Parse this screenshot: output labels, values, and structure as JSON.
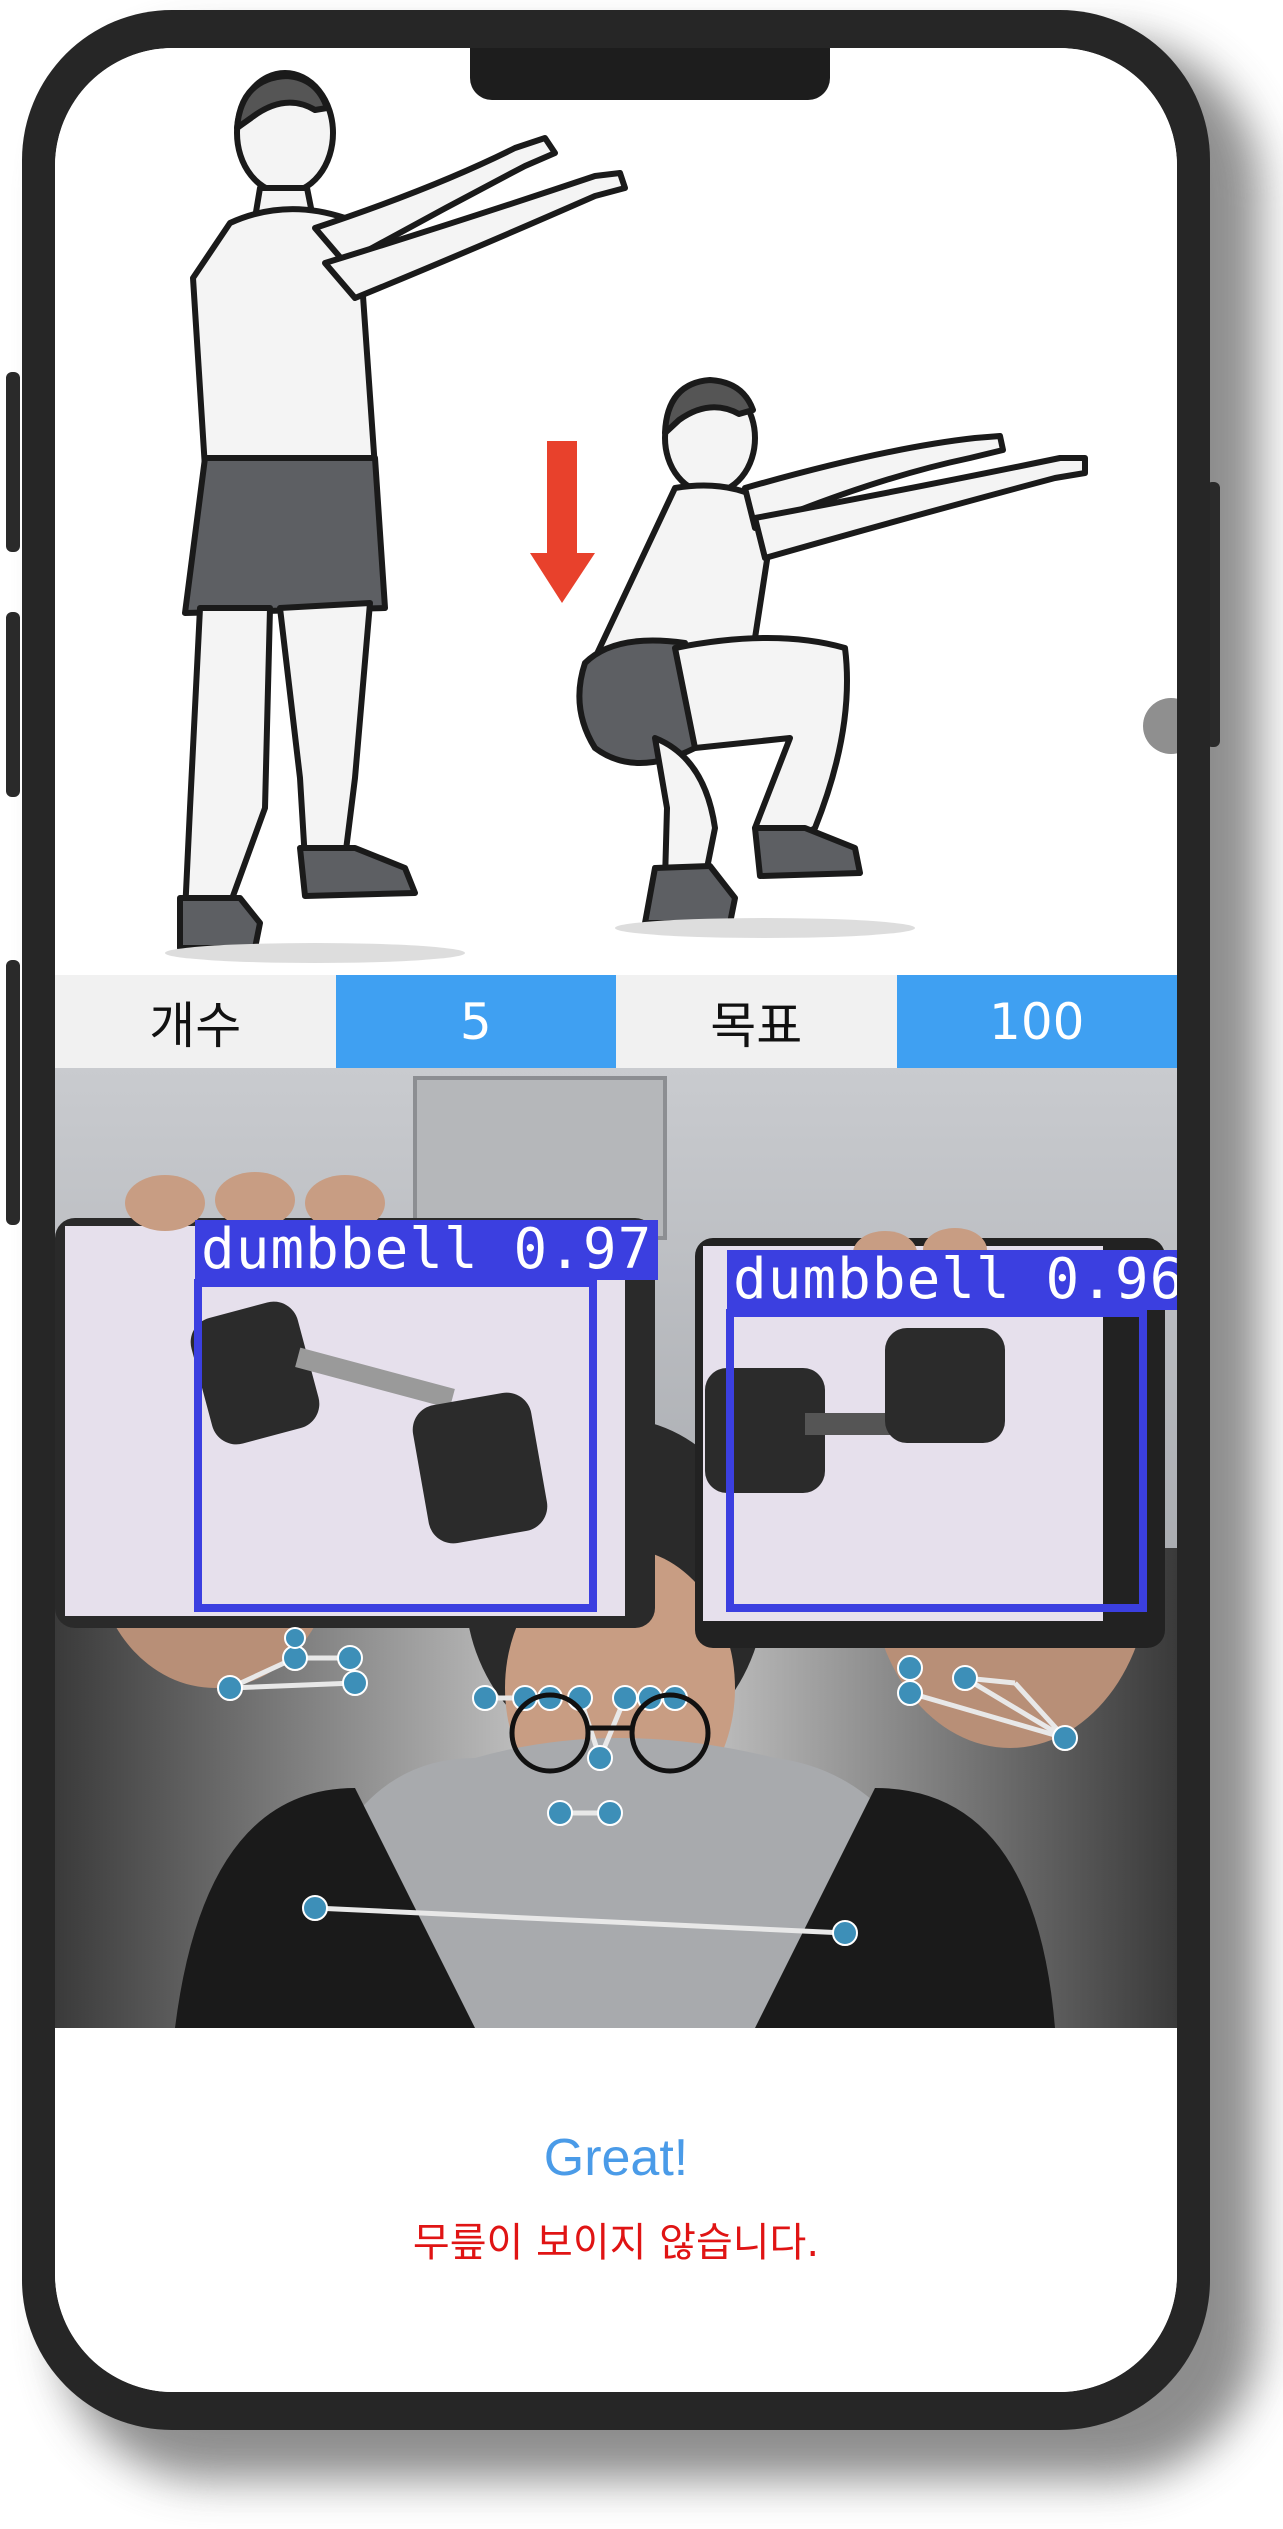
{
  "exercise": {
    "illustration_name": "squat",
    "arrow_color": "#e8412c"
  },
  "stats": {
    "count_label": "개수",
    "count_value": "5",
    "goal_label": "목표",
    "goal_value": "100"
  },
  "camera": {
    "detections": [
      {
        "label": "dumbbell",
        "confidence": "0.97"
      },
      {
        "label": "dumbbell",
        "confidence": "0.96"
      }
    ],
    "keypoint_color": "#3d8fb8",
    "box_color": "#3b3fe0"
  },
  "feedback": {
    "message": "Great!",
    "warning": "무릎이 보이지 않습니다."
  },
  "colors": {
    "accent": "#3fa0f2",
    "warning": "#e01414",
    "message": "#4a9be8"
  }
}
